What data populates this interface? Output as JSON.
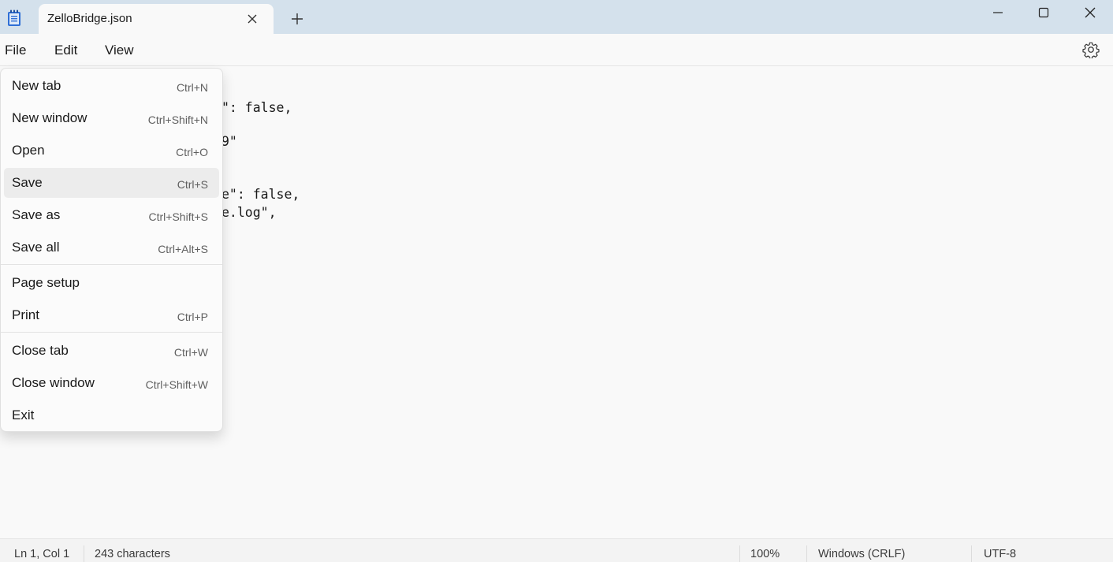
{
  "window": {
    "tab_title": "ZelloBridge.json"
  },
  "menubar": {
    "items": [
      "File",
      "Edit",
      "View"
    ]
  },
  "editor": {
    "visible_lines": [
      "\": false,",
      "9\"",
      "e\": false,",
      "e.log\","
    ]
  },
  "file_menu": {
    "items": [
      {
        "label": "New tab",
        "shortcut": "Ctrl+N"
      },
      {
        "label": "New window",
        "shortcut": "Ctrl+Shift+N"
      },
      {
        "label": "Open",
        "shortcut": "Ctrl+O"
      },
      {
        "label": "Save",
        "shortcut": "Ctrl+S"
      },
      {
        "label": "Save as",
        "shortcut": "Ctrl+Shift+S"
      },
      {
        "label": "Save all",
        "shortcut": "Ctrl+Alt+S"
      },
      {
        "label": "Page setup",
        "shortcut": ""
      },
      {
        "label": "Print",
        "shortcut": "Ctrl+P"
      },
      {
        "label": "Close tab",
        "shortcut": "Ctrl+W"
      },
      {
        "label": "Close window",
        "shortcut": "Ctrl+Shift+W"
      },
      {
        "label": "Exit",
        "shortcut": ""
      }
    ],
    "highlighted_item": "Save"
  },
  "statusbar": {
    "position": "Ln 1, Col 1",
    "characters": "243 characters",
    "zoom": "100%",
    "line_ending": "Windows (CRLF)",
    "encoding": "UTF-8"
  },
  "icons": {
    "app": "notepad-icon",
    "tab_close": "close-icon",
    "new_tab": "plus-icon",
    "minimize": "minimize-icon",
    "maximize": "maximize-icon",
    "close_window": "close-icon",
    "settings": "gear-icon"
  },
  "colors": {
    "titlebar": "#d4e1ec",
    "background": "#f9f9f9",
    "menu_highlight": "#ececec",
    "app_icon": "#2f6fd6"
  }
}
